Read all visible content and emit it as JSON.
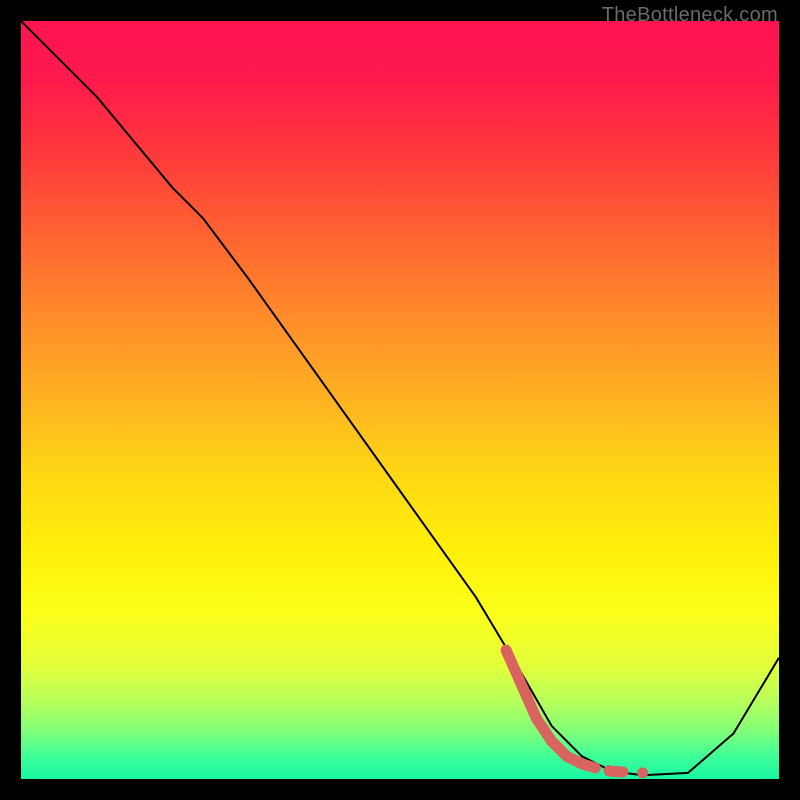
{
  "watermark": "TheBottleneck.com",
  "chart_data": {
    "type": "line",
    "title": "",
    "xlabel": "",
    "ylabel": "",
    "xlim": [
      0,
      100
    ],
    "ylim": [
      0,
      100
    ],
    "series": [
      {
        "name": "curve",
        "color": "#000000",
        "stroke_width": 2,
        "x": [
          0,
          10,
          20,
          24,
          30,
          40,
          50,
          60,
          66,
          70,
          74,
          78,
          82,
          88,
          94,
          100
        ],
        "y": [
          100,
          90,
          78,
          74,
          66,
          52,
          38,
          24,
          14,
          7,
          3,
          1,
          0.5,
          0.8,
          6,
          16
        ]
      },
      {
        "name": "highlight",
        "color": "#d9645f",
        "stroke_width": 10,
        "style": "dashed-tail",
        "x": [
          64,
          68,
          70,
          72,
          74,
          76,
          78,
          80,
          82
        ],
        "y": [
          17,
          8,
          5,
          3,
          2,
          1.4,
          1,
          0.9,
          0.8
        ]
      }
    ],
    "gradient_stops": [
      {
        "pos": 0,
        "color": "#ff1452"
      },
      {
        "pos": 50,
        "color": "#ffd814"
      },
      {
        "pos": 85,
        "color": "#e3ff3a"
      },
      {
        "pos": 100,
        "color": "#17f7a1"
      }
    ]
  }
}
